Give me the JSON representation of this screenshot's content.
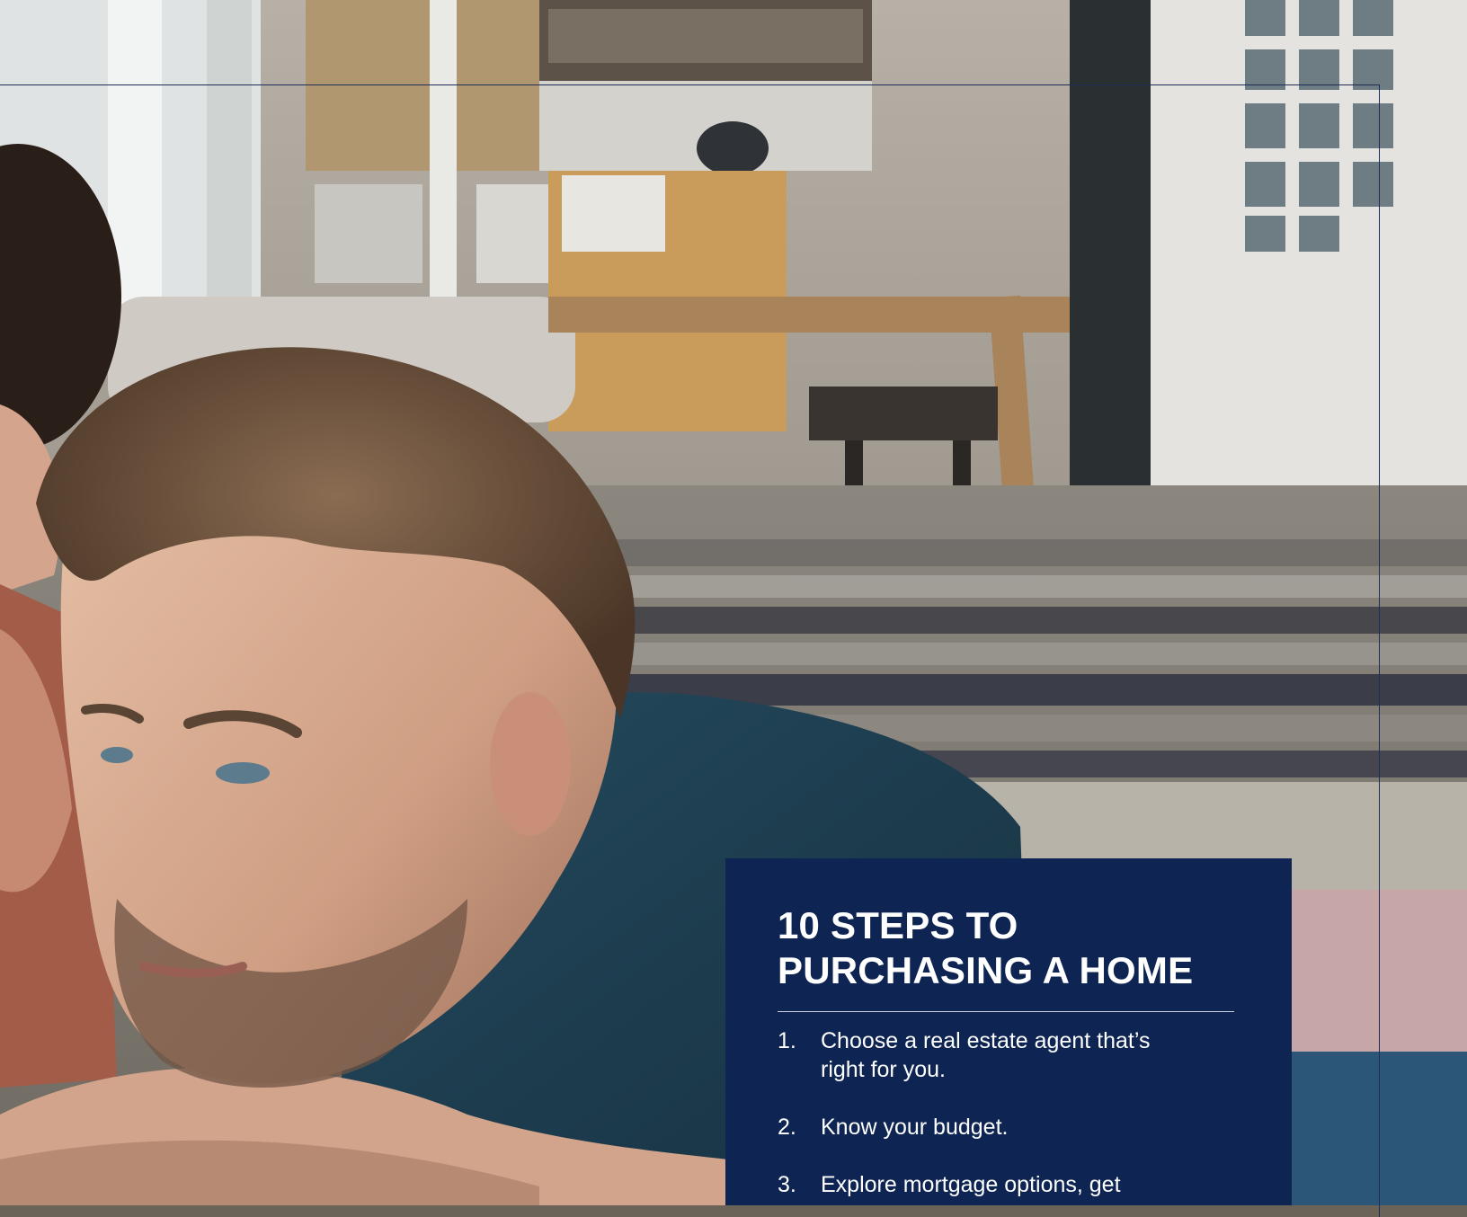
{
  "brochure": {
    "title_line1": "10 STEPS TO",
    "title_line2": "PURCHASING A HOME",
    "steps": [
      {
        "number": "1.",
        "text": "Choose a real estate agent that’s right for you."
      },
      {
        "number": "2.",
        "text": "Know your budget."
      },
      {
        "number": "3.",
        "text": "Explore mortgage options, get"
      }
    ]
  },
  "colors": {
    "panel": "#0e2452",
    "frame_line": "#1d2d55",
    "text": "#ffffff"
  }
}
